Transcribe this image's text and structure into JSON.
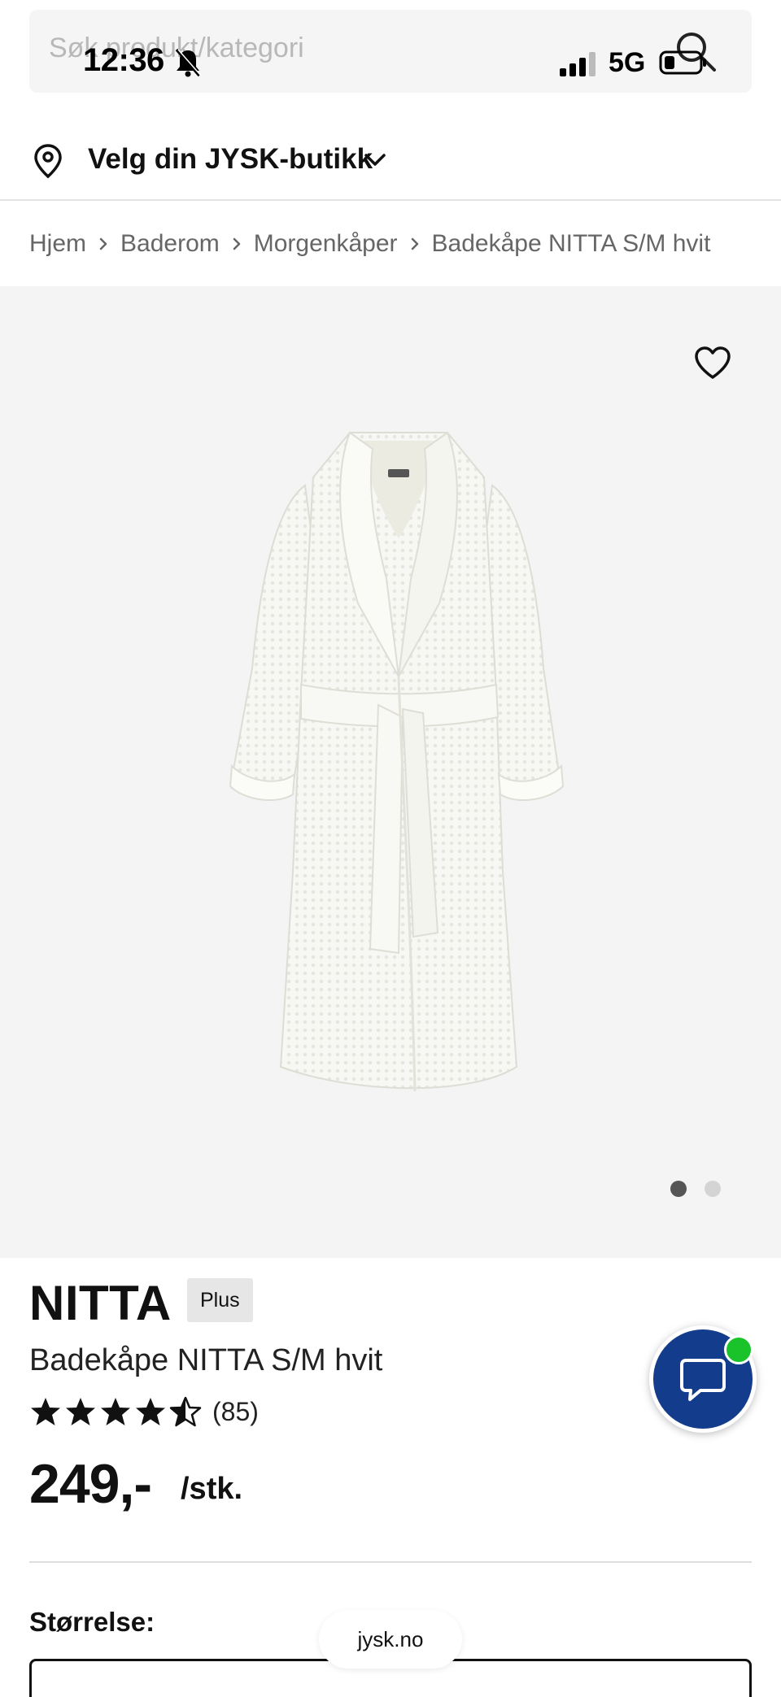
{
  "status_bar": {
    "time": "12:36",
    "network": "5G"
  },
  "search": {
    "placeholder": "Søk produkt/kategori"
  },
  "store_selector": {
    "label": "Velg din JYSK-butikk"
  },
  "breadcrumb": {
    "items": [
      "Hjem",
      "Baderom",
      "Morgenkåper",
      "Badekåpe NITTA S/M hvit"
    ]
  },
  "gallery": {
    "image_count": 2,
    "active_index": 0
  },
  "product": {
    "brand": "NITTA",
    "badge": "Plus",
    "name": "Badekåpe NITTA S/M hvit",
    "rating": 4.5,
    "rating_max": 5,
    "review_count": "(85)",
    "price": "249,-",
    "unit": "/stk."
  },
  "options": {
    "size_label": "Størrelse:"
  },
  "browser": {
    "url": "jysk.no"
  },
  "colors": {
    "chat_button": "#143c8c",
    "online_indicator": "#1bc32b",
    "image_background": "#f4f4f4"
  }
}
